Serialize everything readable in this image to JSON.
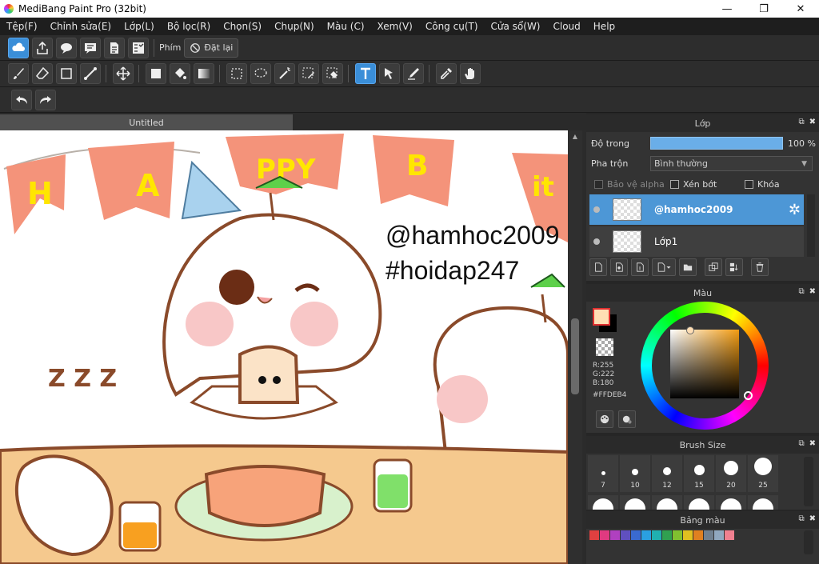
{
  "app": {
    "title": "MediBang Paint Pro (32bit)"
  },
  "window_controls": {
    "minimize": "—",
    "restore": "❐",
    "close": "✕"
  },
  "menu": [
    "Tệp(F)",
    "Chỉnh sửa(E)",
    "Lớp(L)",
    "Bộ lọc(R)",
    "Chọn(S)",
    "Chụp(N)",
    "Màu (C)",
    "Xem(V)",
    "Công cụ(T)",
    "Cửa sổ(W)",
    "Cloud",
    "Help"
  ],
  "toolbar1": {
    "shortcut_label": "Phím",
    "reset_label": "Đặt lại"
  },
  "document": {
    "tab_title": "Untitled"
  },
  "canvas": {
    "banner_letters": [
      "H",
      "A",
      "PPY",
      "B",
      "it"
    ],
    "watermark_line1": "@hamhoc2009",
    "watermark_line2": "#hoidap247",
    "sleep_letters": "Z Z Z"
  },
  "layer_panel": {
    "title": "Lớp",
    "opacity_label": "Độ trong",
    "opacity_value": "100 %",
    "opacity_fraction": 1.0,
    "blend_label": "Pha trộn",
    "blend_value": "Bình thường",
    "protect_alpha_label": "Bảo vệ alpha",
    "clip_label": "Xén bớt",
    "lock_label": "Khóa",
    "layers": [
      {
        "name": "@hamhoc2009",
        "selected": true
      },
      {
        "name": "Lớp1",
        "selected": false
      }
    ]
  },
  "color_panel": {
    "title": "Màu",
    "r_label": "R:255",
    "g_label": "G:222",
    "b_label": "B:180",
    "hex": "#FFDEB4",
    "foreground_color": "#FFDEB4",
    "background_color": "#000000"
  },
  "brush_panel": {
    "title": "Brush Size",
    "sizes": [
      "7",
      "10",
      "12",
      "15",
      "20",
      "25"
    ]
  },
  "palette_panel": {
    "title": "Bảng màu",
    "swatches": [
      "#e04040",
      "#e03a80",
      "#b040c0",
      "#6050c0",
      "#3a6ad0",
      "#2aa0e0",
      "#20b0b0",
      "#30a050",
      "#80c030",
      "#e0c020",
      "#e08020",
      "#708090",
      "#90a8c0",
      "#f08090"
    ]
  }
}
